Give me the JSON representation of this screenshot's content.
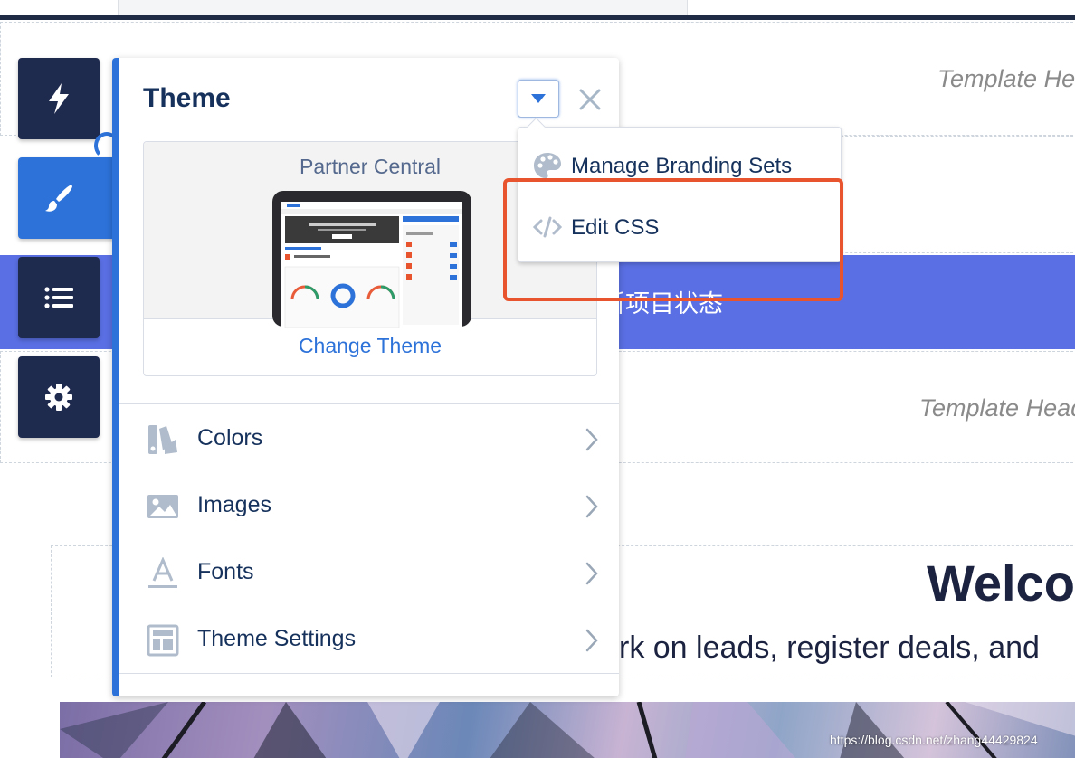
{
  "canvas": {
    "template_header_1": "Template Hea",
    "template_header_2": "Template Head",
    "purple_text": "新项目状态",
    "welcome_title": "Welco",
    "welcome_subtitle": "rk on leads, register deals, and",
    "watermark": "https://blog.csdn.net/zhang44429824"
  },
  "rail": {
    "items": [
      {
        "name": "components",
        "icon": "lightning-icon"
      },
      {
        "name": "theme",
        "icon": "brush-icon"
      },
      {
        "name": "page-structure",
        "icon": "list-icon"
      },
      {
        "name": "settings",
        "icon": "gear-icon"
      }
    ]
  },
  "panel": {
    "title": "Theme",
    "preview": {
      "theme_name": "Partner Central",
      "change_link": "Change Theme"
    },
    "menu": [
      {
        "label": "Colors",
        "icon": "color-swatch-icon"
      },
      {
        "label": "Images",
        "icon": "image-icon"
      },
      {
        "label": "Fonts",
        "icon": "font-icon"
      },
      {
        "label": "Theme Settings",
        "icon": "layout-icon"
      }
    ]
  },
  "dropdown": {
    "items": [
      {
        "label": "Manage Branding Sets",
        "icon": "palette-icon"
      },
      {
        "label": "Edit CSS",
        "icon": "code-icon"
      }
    ]
  },
  "colors": {
    "accent": "#2d72d9",
    "rail": "#1f2a4f",
    "highlight": "#e8542d",
    "band": "#5a6fe3"
  }
}
